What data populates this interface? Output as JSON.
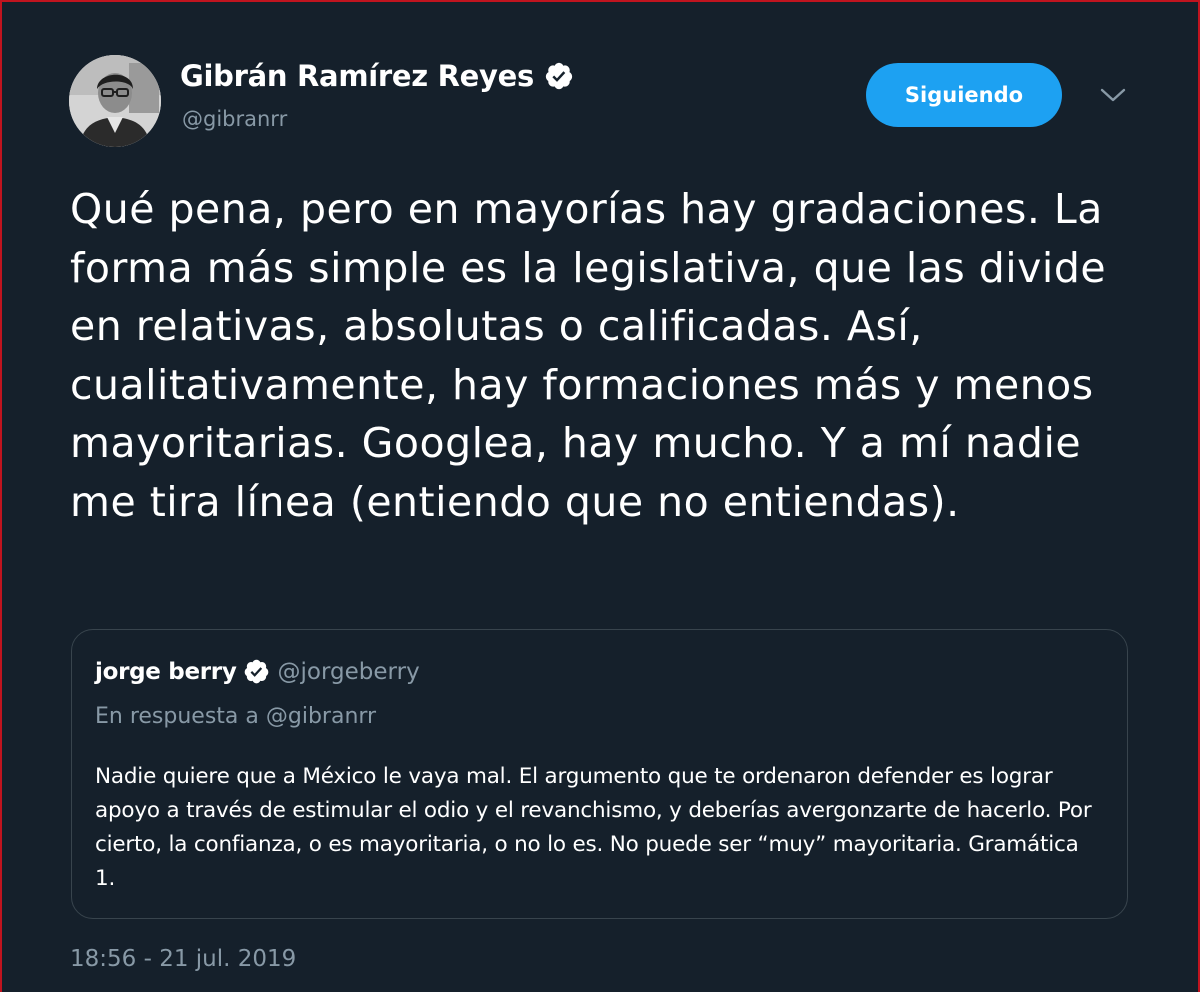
{
  "author": {
    "name": "Gibrán Ramírez Reyes",
    "handle": "@gibranrr",
    "verified_icon": "verified-badge-icon"
  },
  "follow_button": {
    "label": "Siguiendo"
  },
  "menu_icon": "chevron-down-icon",
  "tweet": {
    "text": "Qué pena, pero en mayorías hay gradaciones. La forma más simple es la legislativa, que las divide en relativas, absolutas o calificadas. Así, cualitativamente, hay formaciones más y menos mayoritarias. Googlea, hay mucho. Y a mí nadie me tira línea (entiendo que no entiendas).",
    "timestamp": "18:56 - 21 jul. 2019"
  },
  "quoted_tweet": {
    "name": "jorge berry",
    "handle": "@jorgeberry",
    "reply_prefix": "En respuesta a",
    "reply_to": "@gibranrr",
    "text": "Nadie quiere que a México le vaya mal. El argumento que te ordenaron defender es lograr apoyo a través de estimular el odio y el revanchismo, y deberías avergonzarte de hacerlo. Por cierto, la confianza, o es mayoritaria, o no lo es. No puede ser “muy” mayoritaria. Gramática 1."
  },
  "colors": {
    "background": "#15202b",
    "accent": "#1da1f2",
    "secondary_text": "#8899a6",
    "border": "#38444d",
    "frame": "#c0141f"
  }
}
